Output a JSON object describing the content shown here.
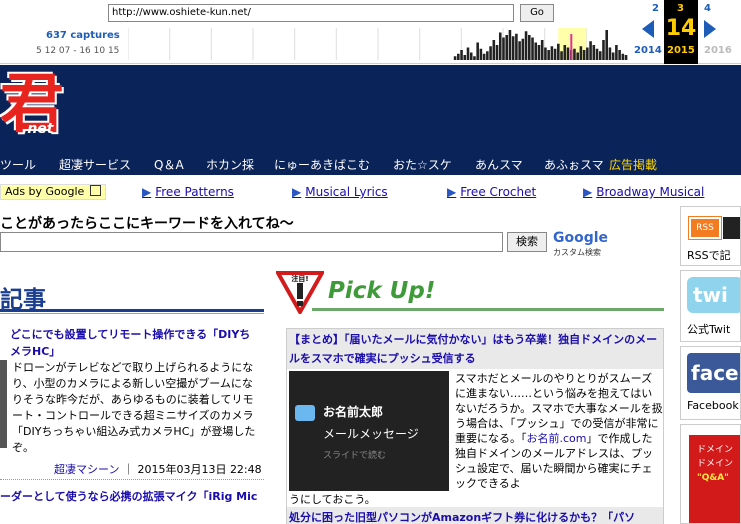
{
  "wayback": {
    "url": "http://www.oshiete-kun.net/",
    "go_label": "Go",
    "captures": "637 captures",
    "range": "5 12 07 - 16 10 15",
    "prev_num": "2",
    "cur_num": "3",
    "next_num": "4",
    "day": "14",
    "prev_year": "2014",
    "cur_year": "2015",
    "next_year": "2016",
    "sparkline": [
      0,
      0,
      0,
      0,
      0,
      0,
      0,
      0,
      0,
      0,
      0,
      0,
      0,
      0,
      0,
      0,
      0,
      0,
      0,
      0,
      0,
      0,
      0,
      0,
      0,
      0,
      0,
      0,
      0,
      0,
      0,
      0,
      0,
      0,
      0,
      0,
      0,
      0,
      0,
      0,
      0,
      0,
      0,
      0,
      0,
      0,
      0,
      0,
      0,
      0,
      0,
      0,
      0,
      0,
      0,
      0,
      0,
      0,
      0,
      0,
      0,
      0,
      0,
      0,
      0,
      0,
      0,
      0,
      0,
      0,
      0,
      0,
      0,
      0,
      0,
      0,
      0,
      0,
      0,
      0,
      0,
      0,
      0,
      0,
      0,
      0,
      0,
      0,
      0,
      0,
      0,
      0,
      0,
      0,
      0,
      0,
      0,
      0,
      0,
      0,
      0,
      3,
      5,
      8,
      4,
      10,
      6,
      3,
      14,
      9,
      5,
      7,
      11,
      16,
      12,
      22,
      18,
      20,
      24,
      19,
      21,
      15,
      17,
      23,
      20,
      18,
      14,
      12,
      16,
      10,
      8,
      11,
      9,
      13,
      7,
      12,
      10,
      8,
      9,
      6,
      11,
      8,
      10,
      15,
      12,
      9,
      7,
      16,
      24,
      10,
      6,
      12,
      8,
      5,
      4
    ]
  },
  "site": {
    "logo_char": "君",
    "logo_net": ".net"
  },
  "nav": {
    "items": [
      "ツール",
      "超凄サービス",
      "Q＆A",
      "ホカン採",
      "にゅーあきばこむ",
      "おた☆スケ",
      "あんスマ",
      "あふぉスマ",
      "広告掲載"
    ]
  },
  "ads": {
    "label": "Ads by Google",
    "links": [
      "Free Patterns",
      "Musical Lyrics",
      "Free Crochet",
      "Broadway Musical"
    ]
  },
  "search": {
    "prompt": "ことがあったらここにキーワードを入れてね～",
    "button": "検索",
    "google": "Google",
    "custom": "カスタム検索"
  },
  "left": {
    "section_title": "記事",
    "article_title": "どこにでも設置してリモート操作できる「DIYちメラHC」",
    "article_body": "ドローンがテレビなどで取り上げられるようになり、小型のカメラによる新しい空撮がブームになりそうな昨今だが、あらゆるものに装着してリモート・コントロールできる超ミニサイズのカメラ「DIYちっちゃい組込み式カメラHC」が登場したぞ。",
    "article_category": "超凄マシーン",
    "article_date": "2015年03月13日 22:48",
    "article2_title": "ーダーとして使うなら必携の拡張マイク「iRig Mic"
  },
  "pickup": {
    "sign": "注目!",
    "title": "Pick Up!",
    "headline": "【まとめ】「届いたメールに気付かない」はもう卒業！独自ドメインのメールをスマホで確実にプッシュ受信する",
    "img_sender": "お名前太郎",
    "img_message": "メールメッセージ",
    "img_slide": "スライドで読む",
    "body_before": "スマホだとメールのやりとりがスムーズに進まない……という悩みを抱えてはいないだろうか。スマホで大事なメールを扱う場合は、「プッシュ」での受信が非常に重要になる。「",
    "body_link": "お名前.com",
    "body_after": "」で作成した独自ドメインのメールアドレスは、プッシュ設定で、届いた瞬間から確実にチェックできるよ",
    "body_tail": "うにしておこう。",
    "next_headline": "処分に困った旧型パソコンがAmazonギフト券に化けるかも？「パソ"
  },
  "right": {
    "rss_label": "RSSで記",
    "rss_badge": "RSS",
    "twitter_logo": "twi",
    "twitter_label": "公式Twit",
    "facebook_logo": "face",
    "facebook_label": "Facebook",
    "promo_lines": [
      "ドメイン",
      "ドメイン",
      "\"Q&A\""
    ]
  }
}
